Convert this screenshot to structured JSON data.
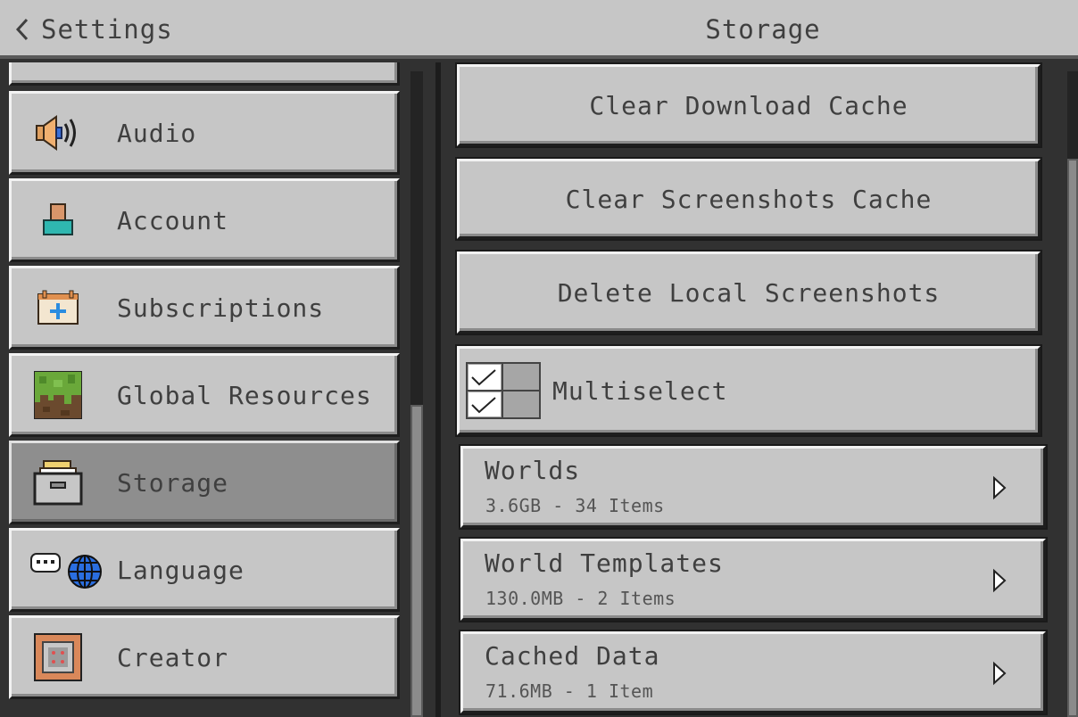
{
  "header": {
    "back_label": "Settings",
    "title": "Storage"
  },
  "sidebar": {
    "items": [
      {
        "label": "Audio",
        "icon": "speaker-icon"
      },
      {
        "label": "Account",
        "icon": "account-icon"
      },
      {
        "label": "Subscriptions",
        "icon": "calendar-plus-icon"
      },
      {
        "label": "Global Resources",
        "icon": "grass-block-icon"
      },
      {
        "label": "Storage",
        "icon": "storage-box-icon",
        "selected": true
      },
      {
        "label": "Language",
        "icon": "language-globe-icon"
      },
      {
        "label": "Creator",
        "icon": "command-block-icon"
      }
    ]
  },
  "main": {
    "buttons": [
      {
        "label": "Clear Download Cache"
      },
      {
        "label": "Clear Screenshots Cache"
      },
      {
        "label": "Delete Local Screenshots"
      }
    ],
    "multiselect": {
      "label": "Multiselect"
    },
    "storage_rows": [
      {
        "title": "Worlds",
        "subtitle": "3.6GB - 34 Items"
      },
      {
        "title": "World Templates",
        "subtitle": "130.0MB - 2 Items"
      },
      {
        "title": "Cached Data",
        "subtitle": "71.6MB - 1 Item"
      }
    ]
  },
  "colors": {
    "panel": "#c6c6c6",
    "selected": "#8e8e8e",
    "background": "#313131",
    "text": "#3f3f3f"
  }
}
